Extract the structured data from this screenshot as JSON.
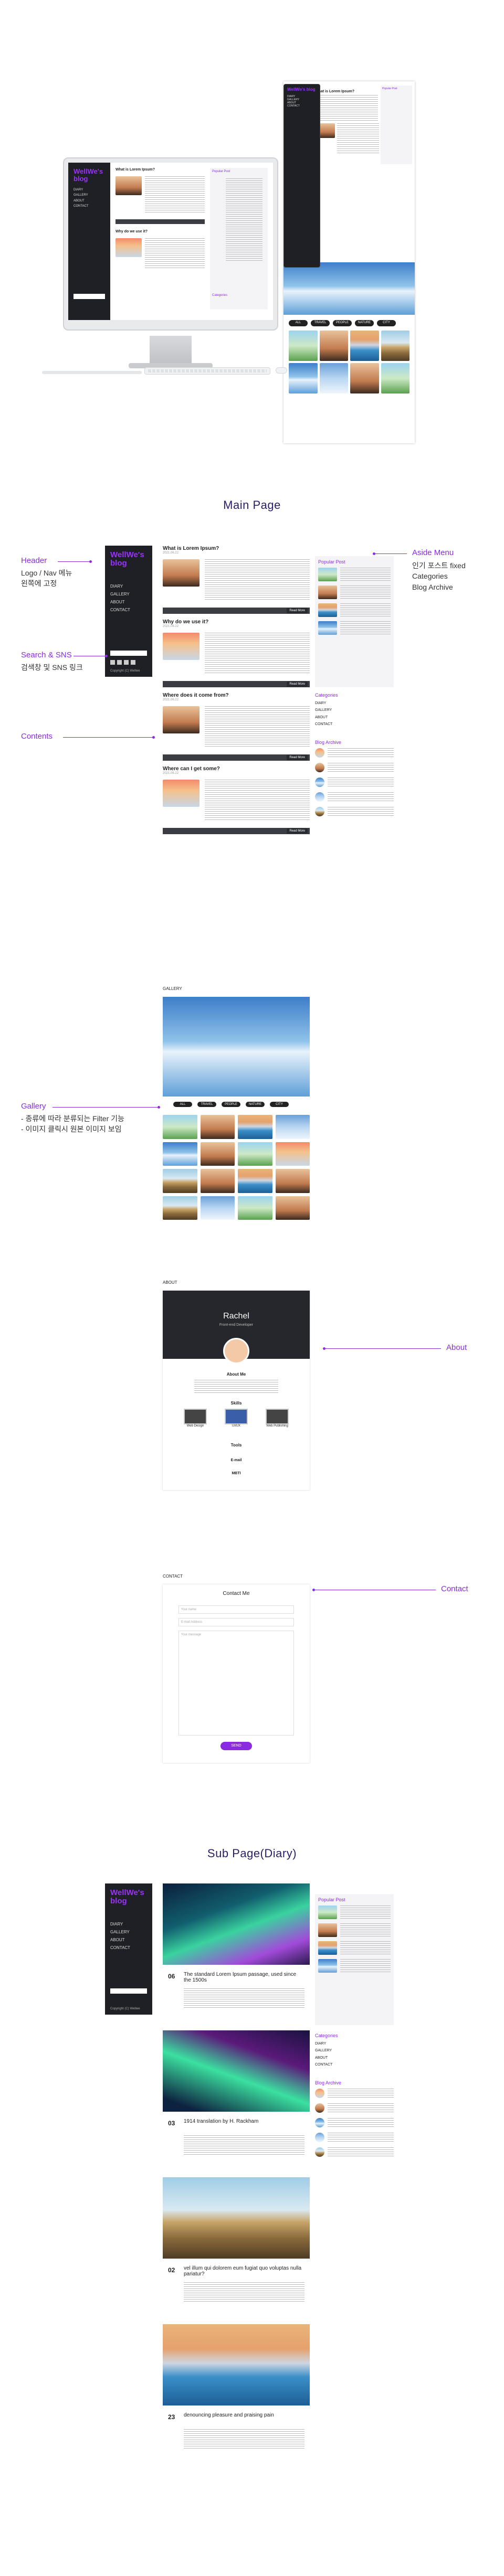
{
  "blog": {
    "logo": "WellWe's blog",
    "menu": [
      "DIARY",
      "GALLERY",
      "ABOUT",
      "CONTACT"
    ],
    "copyright": "Copyright (C) Wellwe"
  },
  "sections": {
    "main_page": "Main Page",
    "sub_page": "Sub Page(Diary)"
  },
  "annotations": {
    "header": {
      "title": "Header",
      "lines": [
        "Logo / Nav 메뉴",
        "왼쪽에 고정"
      ]
    },
    "search_sns": {
      "title": "Search & SNS",
      "lines": [
        "검색창 및 SNS 링크"
      ]
    },
    "contents": {
      "title": "Contents"
    },
    "gallery": {
      "title": "Gallery",
      "lines": [
        "- 종류에 따라 분류되는 Filter 기능",
        "- 이미지 클릭시 원본 이미지 보임"
      ]
    },
    "aside": {
      "title": "Aside Menu",
      "lines": [
        "인기 포스트 fixed",
        "Categories",
        "Blog Archive"
      ]
    },
    "about": {
      "title": "About"
    },
    "contact": {
      "title": "Contact"
    }
  },
  "posts": [
    {
      "title": "What is Lorem Ipsum?",
      "meta": "2021.06.22"
    },
    {
      "title": "Why do we use it?",
      "meta": "2021.06.22"
    },
    {
      "title": "Where does it come from?",
      "meta": "2021.06.22"
    },
    {
      "title": "Where can I get some?",
      "meta": "2021.06.22"
    }
  ],
  "aside_labels": {
    "popular": "Popular Post",
    "categories": "Categories",
    "archive": "Blog Archive",
    "category_items": [
      "DIARY",
      "GALLERY",
      "ABOUT",
      "CONTACT"
    ]
  },
  "read_more": "Read More",
  "gallery": {
    "label": "GALLERY",
    "filters": [
      "ALL",
      "TRAVEL",
      "PEOPLE",
      "NATURE",
      "CITY"
    ]
  },
  "about": {
    "label": "ABOUT",
    "name": "Rachel",
    "subtitle": "Front-end Developer",
    "about_me": "About Me",
    "skills": "Skills",
    "skill_items": [
      "Web Design",
      "UI/UX",
      "Web Publishing"
    ],
    "tools": "Tools",
    "email_label": "E-mail",
    "mbti_label": "MBTI"
  },
  "contact": {
    "label": "CONTACT",
    "heading": "Contact Me",
    "name_placeholder": "Your name",
    "email_placeholder": "E-mail Address",
    "message_placeholder": "Your message",
    "send": "SEND"
  },
  "diary": [
    {
      "day": "06",
      "title": "The standard Lorem Ipsum passage, used since the 1500s"
    },
    {
      "day": "03",
      "title": "1914 translation by H. Rackham"
    },
    {
      "day": "02",
      "title": "vel illum qui dolorem eum fugiat quo voluptas nulla pariatur?"
    },
    {
      "day": "23",
      "title": "denouncing pleasure and praising pain"
    }
  ],
  "colors": {
    "accent": "#8a2be2",
    "sidebar": "#1f2025",
    "title": "#2a1e66"
  }
}
